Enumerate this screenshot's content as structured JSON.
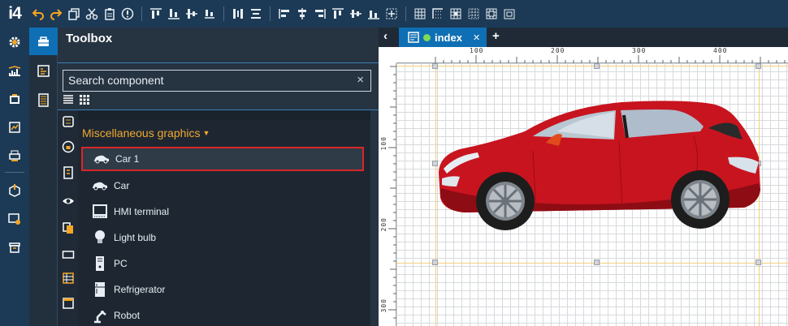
{
  "app": {
    "logo": "i4"
  },
  "toolbar": {
    "icons": [
      "undo-icon",
      "redo-icon",
      "copy-icon",
      "cut-icon",
      "paste-icon",
      "info-icon",
      "align-top-icon",
      "align-bottom-icon",
      "align-middle-icon",
      "distribute-horizontal-icon",
      "distribute-vertical-icon",
      "align-left-icon",
      "align-center-icon",
      "align-right-icon",
      "align-top-edge-icon",
      "align-vcenter-icon",
      "align-bottom-edge-icon",
      "center-icon",
      "grid-icon",
      "corner-icon",
      "snap-grid-icon",
      "grid-dots-icon",
      "grid-alt-icon",
      "frame-icon"
    ]
  },
  "toolbox": {
    "title": "Toolbox",
    "search_placeholder": "Search component",
    "group": "Miscellaneous graphics",
    "items": [
      {
        "label": "Car 1",
        "icon": "car-icon"
      },
      {
        "label": "Car",
        "icon": "car-icon"
      },
      {
        "label": "HMI terminal",
        "icon": "hmi-terminal-icon"
      },
      {
        "label": "Light bulb",
        "icon": "light-bulb-icon"
      },
      {
        "label": "PC",
        "icon": "pc-icon"
      },
      {
        "label": "Refrigerator",
        "icon": "refrigerator-icon"
      },
      {
        "label": "Robot",
        "icon": "robot-icon"
      }
    ]
  },
  "editor": {
    "tab": "index",
    "ruler_h": [
      "100",
      "200",
      "300",
      "400"
    ],
    "ruler_v": [
      "100",
      "200",
      "300"
    ]
  },
  "colors": {
    "accent": "#0f6fb4",
    "group": "#f0a830",
    "selection": "#d9262a",
    "car": "#c8141f"
  }
}
